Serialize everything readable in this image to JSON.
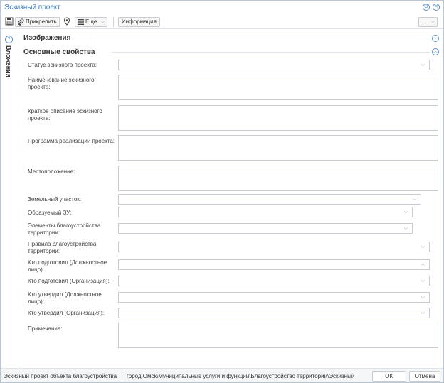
{
  "window": {
    "title": "Эскизный проект"
  },
  "toolbar": {
    "attach_label": "Прикрепить",
    "more_label": "Еще",
    "info_label": "Информация",
    "extra_label": "..."
  },
  "sidebar": {
    "label": "Вложения"
  },
  "sections": {
    "images_title": "Изображения",
    "main_title": "Основные свойства"
  },
  "fields": {
    "status": "Статус эскизного проекта:",
    "name": "Наименование эскизного проекта:",
    "short_desc": "Краткое описание эскизного проекта:",
    "program": "Программа реализации проекта:",
    "location": "Местоположение:",
    "land_plot": "Земельный участок:",
    "formed_plot": "Образуемый ЗУ:",
    "elements": "Элементы благоустройства территории:",
    "rules": "Правила благоустройства территории:",
    "prepared_person": "Кто подготовил (Должностное лицо):",
    "prepared_org": "Кто подготовил (Организация):",
    "approved_person": "Кто утвердил (Должностное лицо):",
    "approved_org": "Кто утвердил (Организация):",
    "note": "Примечание:"
  },
  "statusbar": {
    "object_type": "Эскизный проект объекта благоустройства",
    "path": "город Омск\\Муниципальные услуги и функции\\Благоустройство территории\\Эскизный п...",
    "ok_label": "OK",
    "cancel_label": "Отмена"
  }
}
